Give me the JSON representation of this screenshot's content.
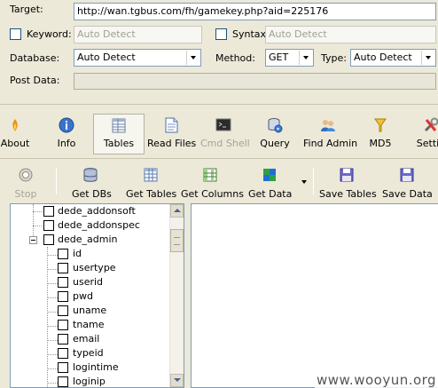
{
  "form": {
    "target_label": "Target:",
    "target_value": "http://wan.tgbus.com/fh/gamekey.php?aid=225176",
    "keyword_label": "Keyword:",
    "keyword_value": "Auto Detect",
    "syntax_label": "Syntax:",
    "syntax_value": "Auto Detect",
    "database_label": "Database:",
    "database_value": "Auto Detect",
    "method_label": "Method:",
    "method_value": "GET",
    "type_label": "Type:",
    "type_value": "Auto Detect",
    "postdata_label": "Post Data:"
  },
  "toolbar_main": [
    {
      "label": "About",
      "icon": "about-icon"
    },
    {
      "label": "Info",
      "icon": "info-icon"
    },
    {
      "label": "Tables",
      "icon": "tables-icon",
      "active": true
    },
    {
      "label": "Read Files",
      "icon": "read-files-icon"
    },
    {
      "label": "Cmd Shell",
      "icon": "cmd-shell-icon",
      "disabled": true
    },
    {
      "label": "Query",
      "icon": "query-icon"
    },
    {
      "label": "Find Admin",
      "icon": "find-admin-icon"
    },
    {
      "label": "MD5",
      "icon": "md5-icon"
    },
    {
      "label": "Settin",
      "icon": "settings-icon"
    }
  ],
  "toolbar_secondary": [
    {
      "label": "Stop",
      "icon": "stop-icon",
      "disabled": true
    },
    {
      "label": "Get DBs",
      "icon": "get-dbs-icon"
    },
    {
      "label": "Get Tables",
      "icon": "get-tables-icon"
    },
    {
      "label": "Get Columns",
      "icon": "get-columns-icon"
    },
    {
      "label": "Get Data",
      "icon": "get-data-icon"
    },
    {
      "label": "Save Tables",
      "icon": "save-tables-icon"
    },
    {
      "label": "Save Data",
      "icon": "save-data-icon"
    }
  ],
  "tree": {
    "tables": [
      "dede_addonsoft",
      "dede_addonspec",
      "dede_admin"
    ],
    "columns": [
      "id",
      "usertype",
      "userid",
      "pwd",
      "uname",
      "tname",
      "email",
      "typeid",
      "logintime",
      "loginip"
    ]
  },
  "watermark": "www.wooyun.org",
  "colors": {
    "window_bg": "#ece9d8",
    "field_border": "#7f9db9",
    "disabled_text": "#a2a08f"
  }
}
